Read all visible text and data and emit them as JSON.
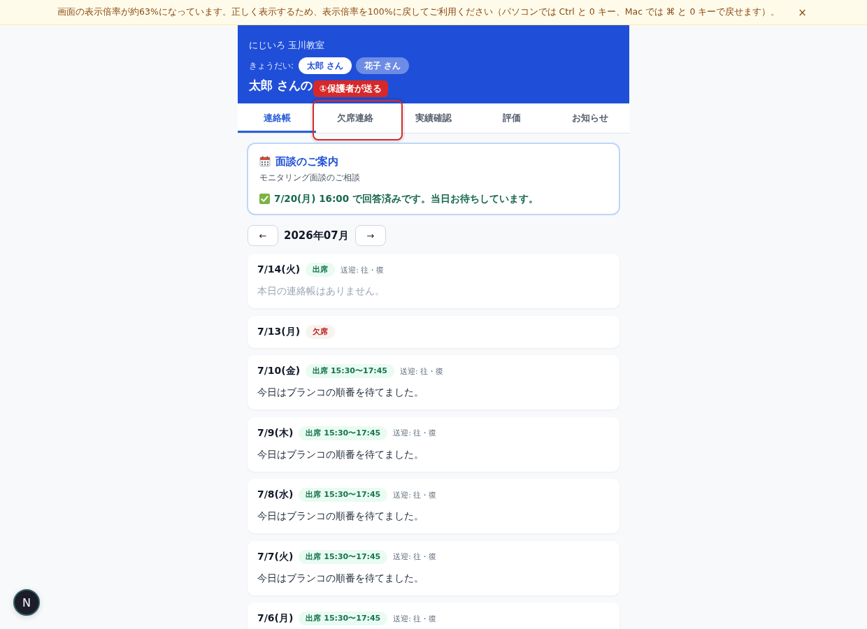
{
  "banner": {
    "message": "画面の表示倍率が約63%になっています。正しく表示するため、表示倍率を100%に戻してご利用ください（パソコンでは Ctrl と 0 キー、Mac では ⌘ と 0 キーで戻せます）。",
    "close": "×"
  },
  "header": {
    "school": "にじいろ 玉川教室",
    "siblings_label": "きょうだい:",
    "siblings": [
      {
        "label": "太郎 さん",
        "selected": true
      },
      {
        "label": "花子 さん",
        "selected": false
      }
    ],
    "title": "太郎 さんの"
  },
  "tabs": [
    {
      "label": "連絡帳",
      "selected": true,
      "highlighted": false
    },
    {
      "label": "欠席連絡",
      "selected": false,
      "highlighted": true,
      "callout": "①保護者が送る"
    },
    {
      "label": "実績確認",
      "selected": false,
      "highlighted": false
    },
    {
      "label": "評価",
      "selected": false,
      "highlighted": false
    },
    {
      "label": "お知らせ",
      "selected": false,
      "highlighted": false
    }
  ],
  "notice": {
    "title": "面談のご案内",
    "subtitle": "モニタリング面談のご相談",
    "status": "7/20(月) 16:00 で回答済みです。当日お待ちしています。"
  },
  "month_nav": {
    "prev": "←",
    "month": "2026年07月",
    "next": "→"
  },
  "entries": [
    {
      "date": "7/14(火)",
      "attendance": {
        "kind": "present",
        "label": "出席"
      },
      "pickup": "送迎: 往・復",
      "note": {
        "kind": "empty",
        "text": "本日の連絡帳はありません。"
      }
    },
    {
      "date": "7/13(月)",
      "attendance": {
        "kind": "absent",
        "label": "欠席"
      }
    },
    {
      "date": "7/10(金)",
      "attendance": {
        "kind": "present",
        "label": "出席 15:30〜17:45"
      },
      "pickup": "送迎: 往・復",
      "note": {
        "kind": "text",
        "text": "今日はブランコの順番を待てました。"
      }
    },
    {
      "date": "7/9(木)",
      "attendance": {
        "kind": "present",
        "label": "出席 15:30〜17:45"
      },
      "pickup": "送迎: 往・復",
      "note": {
        "kind": "text",
        "text": "今日はブランコの順番を待てました。"
      }
    },
    {
      "date": "7/8(水)",
      "attendance": {
        "kind": "present",
        "label": "出席 15:30〜17:45"
      },
      "pickup": "送迎: 往・復",
      "note": {
        "kind": "text",
        "text": "今日はブランコの順番を待てました。"
      }
    },
    {
      "date": "7/7(火)",
      "attendance": {
        "kind": "present",
        "label": "出席 15:30〜17:45"
      },
      "pickup": "送迎: 往・復",
      "note": {
        "kind": "text",
        "text": "今日はブランコの順番を待てました。"
      }
    },
    {
      "date": "7/6(月)",
      "attendance": {
        "kind": "present",
        "label": "出席 15:30〜17:45"
      },
      "pickup": "送迎: 往・復"
    }
  ],
  "dev_badge": {
    "label": "N"
  }
}
